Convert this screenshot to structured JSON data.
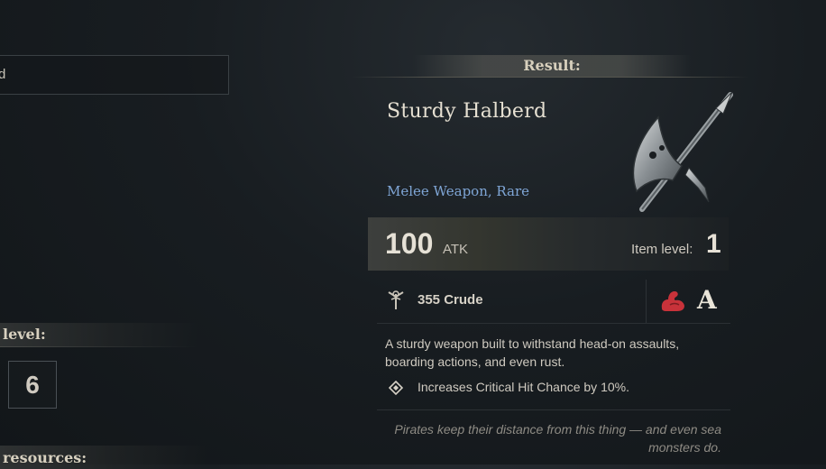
{
  "left_panel": {
    "input_text_partial": "d",
    "level_label_partial": "level:",
    "level_value": "6",
    "resources_label_partial": "resources:"
  },
  "result": {
    "header": "Result:",
    "item_name": "Sturdy Halberd",
    "item_type": "Melee Weapon, Rare",
    "atk_value": "100",
    "atk_label": "ATK",
    "item_level_label": "Item level:",
    "item_level_value": "1",
    "resource_value": "355 Crude",
    "grade": "A",
    "description": "A sturdy weapon built to withstand head-on assaults, boarding actions, and even rust.",
    "perk": "Increases Critical Hit Chance by 10%.",
    "flavor_text": "Pirates keep their distance from this thing — and even sea monsters do."
  },
  "colors": {
    "item_type": "#7fa6d6",
    "muscle_icon": "#c8323a",
    "background": "#181d21"
  },
  "icons": {
    "weapon": "halberd-icon",
    "resource": "crude-resource-icon",
    "requirement": "muscle-strength-icon",
    "perk": "diamond-bullet-icon"
  }
}
